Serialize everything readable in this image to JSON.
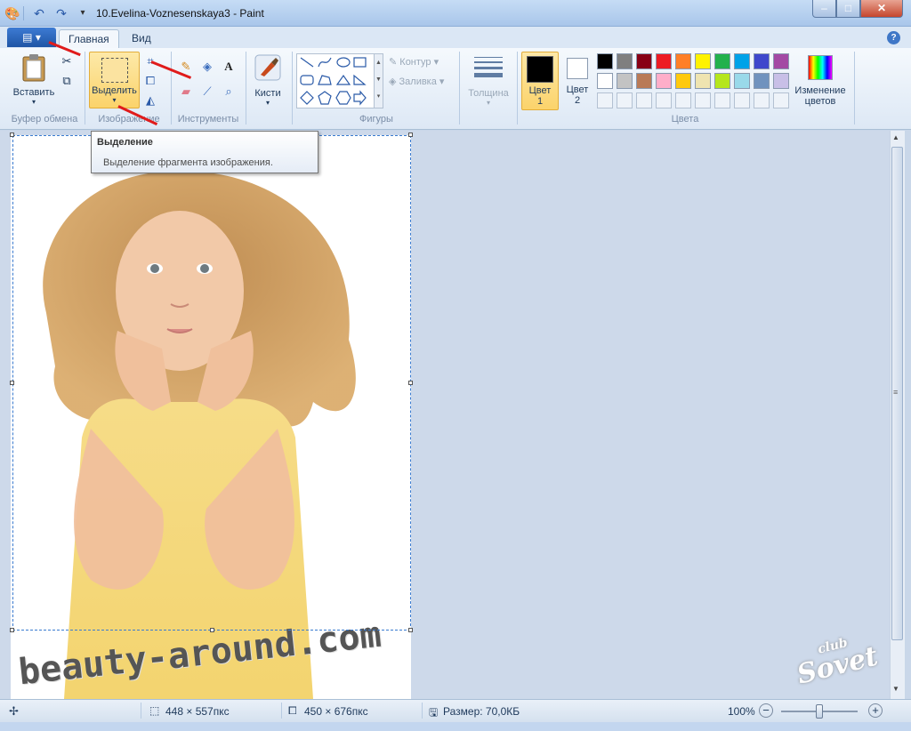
{
  "title_bar": {
    "title": "10.Evelina-Voznesenskaya3 - Paint",
    "qat_icons": [
      "paint-app-icon",
      "save-icon",
      "undo-icon",
      "redo-icon",
      "customize-dropdown-icon"
    ],
    "window_buttons": {
      "minimize": "–",
      "maximize": "□",
      "close": "✕"
    }
  },
  "tabs": {
    "menu_icon": "▤ ▾",
    "home": "Главная",
    "view": "Вид",
    "help": "?"
  },
  "ribbon": {
    "clipboard": {
      "paste_label": "Вставить",
      "group_label": "Буфер обмена"
    },
    "image": {
      "select_label": "Выделить",
      "group_label": "Изображение"
    },
    "tools": {
      "group_label": "Инструменты",
      "text_tool": "A"
    },
    "brushes": {
      "label": "Кисти"
    },
    "shapes": {
      "outline_label": "Контур",
      "fill_label": "Заливка",
      "group_label": "Фигуры"
    },
    "size": {
      "label": "Толщина"
    },
    "colors": {
      "color1_label": "Цвет",
      "color1_num": "1",
      "color2_label": "Цвет",
      "color2_num": "2",
      "edit_colors_line1": "Изменение",
      "edit_colors_line2": "цветов",
      "group_label": "Цвета",
      "palette_row1": [
        "#000000",
        "#7f7f7f",
        "#880015",
        "#ed1c24",
        "#ff7f27",
        "#fff200",
        "#22b14c",
        "#00a2e8",
        "#3f48cc",
        "#a349a4"
      ],
      "palette_row2": [
        "#ffffff",
        "#c3c3c3",
        "#b97a57",
        "#ffaec9",
        "#ffc90e",
        "#efe4b0",
        "#b5e61d",
        "#99d9ea",
        "#7092be",
        "#c8bfe7"
      ],
      "color1_value": "#000000",
      "color2_value": "#ffffff"
    }
  },
  "tooltip": {
    "title": "Выделение",
    "text": "Выделение фрагмента изображения."
  },
  "canvas": {
    "watermark": "beauty-around.com",
    "corner_logo_line1": "club",
    "corner_logo_line2": "Sovet"
  },
  "status": {
    "selection_size": "448 × 557пкс",
    "image_size": "450 × 676пкс",
    "file_size": "Размер: 70,0КБ",
    "zoom": "100%",
    "zoom_level": 0.5
  }
}
